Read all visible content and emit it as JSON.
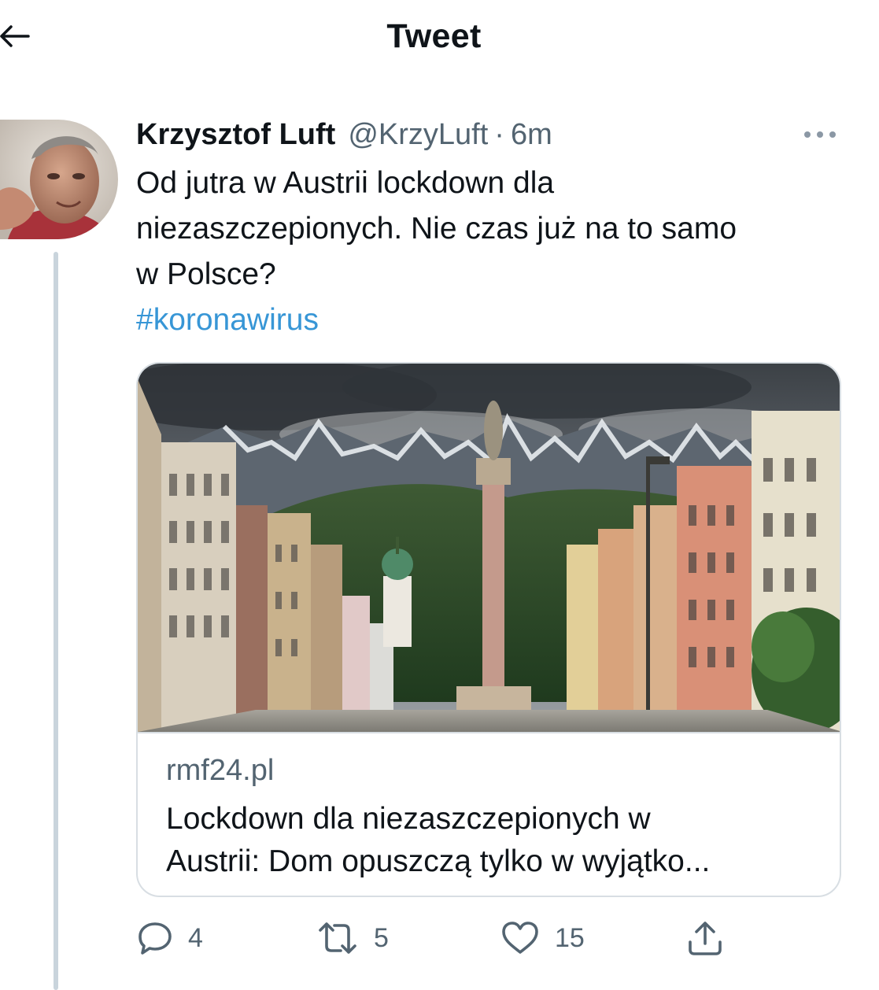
{
  "header": {
    "title": "Tweet",
    "back_icon": "arrow-left-icon"
  },
  "tweet": {
    "author": {
      "display_name": "Krzysztof Luft",
      "handle": "@KrzyLuft",
      "separator": "·",
      "time": "6m"
    },
    "text_lines": [
      "Od jutra w Austrii lockdown dla",
      "niezaszczepionych. Nie czas już na to samo",
      "w Polsce?"
    ],
    "hashtag": "#koronawirus",
    "card": {
      "domain": "rmf24.pl",
      "title_lines": [
        "Lockdown dla niezaszczepionych w",
        "Austrii: Dom opuszczą tylko w wyjątko..."
      ]
    },
    "actions": {
      "replies": "4",
      "retweets": "5",
      "likes": "15"
    }
  },
  "colors": {
    "text": "#0f1419",
    "secondary": "#536471",
    "link": "#1d9bf0",
    "border": "#d8dee3",
    "thread_line": "#c9d4dc"
  }
}
